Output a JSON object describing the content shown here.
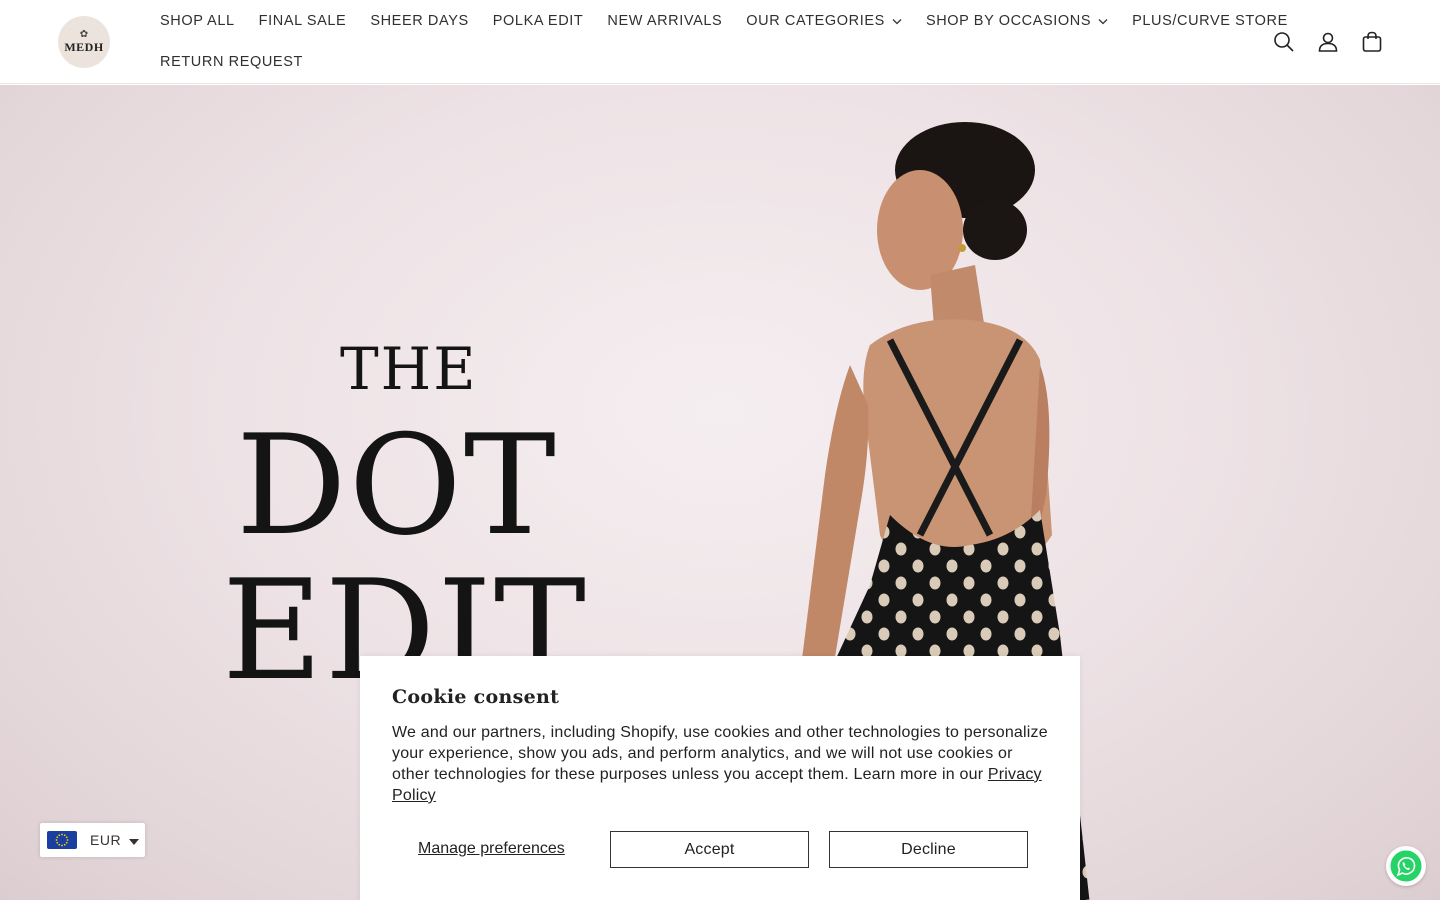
{
  "brand": {
    "logo_text": "MEDH",
    "logo_mark": "✿"
  },
  "nav": {
    "row1": [
      {
        "label": "SHOP ALL",
        "dropdown": false
      },
      {
        "label": "FINAL SALE",
        "dropdown": false
      },
      {
        "label": "SHEER DAYS",
        "dropdown": false
      },
      {
        "label": "POLKA EDIT",
        "dropdown": false
      },
      {
        "label": "NEW ARRIVALS",
        "dropdown": false
      },
      {
        "label": "OUR CATEGORIES",
        "dropdown": true
      },
      {
        "label": "SHOP BY OCCASIONS",
        "dropdown": true
      },
      {
        "label": "PLUS/CURVE STORE",
        "dropdown": false
      }
    ],
    "row2": [
      {
        "label": "RETURN REQUEST",
        "dropdown": false
      }
    ]
  },
  "header_icons": [
    "search-icon",
    "account-icon",
    "cart-icon"
  ],
  "hero": {
    "line1": "THE",
    "line2": "DOT",
    "line3": "EDIT"
  },
  "currency": {
    "code": "EUR",
    "flag": "eu-flag-icon"
  },
  "cookie": {
    "title": "Cookie consent",
    "body": "We and our partners, including Shopify, use cookies and other technologies to personalize your experience, show you ads, and perform analytics, and we will not use cookies or other technologies for these purposes unless you accept them. Learn more in our ",
    "link": "Privacy Policy",
    "manage_label": "Manage preferences",
    "accept_label": "Accept",
    "decline_label": "Decline"
  },
  "colors": {
    "hero_bg": "#eee3e6",
    "text": "#121212",
    "whatsapp": "#25d366",
    "eu_blue": "#1b3f9e"
  }
}
